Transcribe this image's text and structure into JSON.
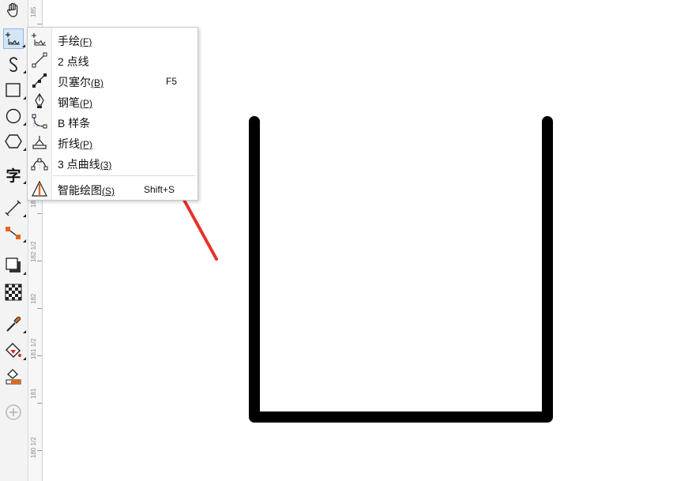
{
  "toolbox": {
    "tools": [
      {
        "name": "pan-tool-icon"
      },
      {
        "name": "freehand-tool-icon"
      },
      {
        "name": "artistic-media-tool-icon"
      },
      {
        "name": "rectangle-tool-icon"
      },
      {
        "name": "ellipse-tool-icon"
      },
      {
        "name": "polygon-tool-icon"
      },
      {
        "name": "text-tool-icon",
        "glyph": "字"
      },
      {
        "name": "dimension-tool-icon"
      },
      {
        "name": "connector-tool-icon"
      },
      {
        "name": "drop-shadow-tool-icon"
      },
      {
        "name": "transparency-tool-icon"
      },
      {
        "name": "eyedropper-tool-icon"
      },
      {
        "name": "interactive-fill-tool-icon"
      },
      {
        "name": "smart-fill-tool-icon"
      },
      {
        "name": "add-tool-icon"
      }
    ]
  },
  "ruler": {
    "labels": [
      "185",
      "182",
      "182 1/2",
      "182",
      "181 1/2",
      "181",
      "180 1/2"
    ]
  },
  "curve_menu": {
    "items": [
      {
        "label": "手绘",
        "accel": "(F)",
        "shortcut": ""
      },
      {
        "label": "2 点线",
        "accel": "",
        "shortcut": ""
      },
      {
        "label": "贝塞尔",
        "accel": "(B)",
        "shortcut": "F5"
      },
      {
        "label": "钢笔",
        "accel": "(P)",
        "shortcut": ""
      },
      {
        "label": "B 样条",
        "accel": "",
        "shortcut": ""
      },
      {
        "label": "折线",
        "accel": "(P)",
        "shortcut": ""
      },
      {
        "label": "3 点曲线",
        "accel": "(3)",
        "shortcut": ""
      },
      {
        "label": "智能绘图",
        "accel": "(S)",
        "shortcut": "Shift+S"
      }
    ]
  },
  "colors": {
    "annotation_arrow": "#e8322b",
    "shape_stroke": "#000000",
    "menu_bg": "#ffffff"
  }
}
